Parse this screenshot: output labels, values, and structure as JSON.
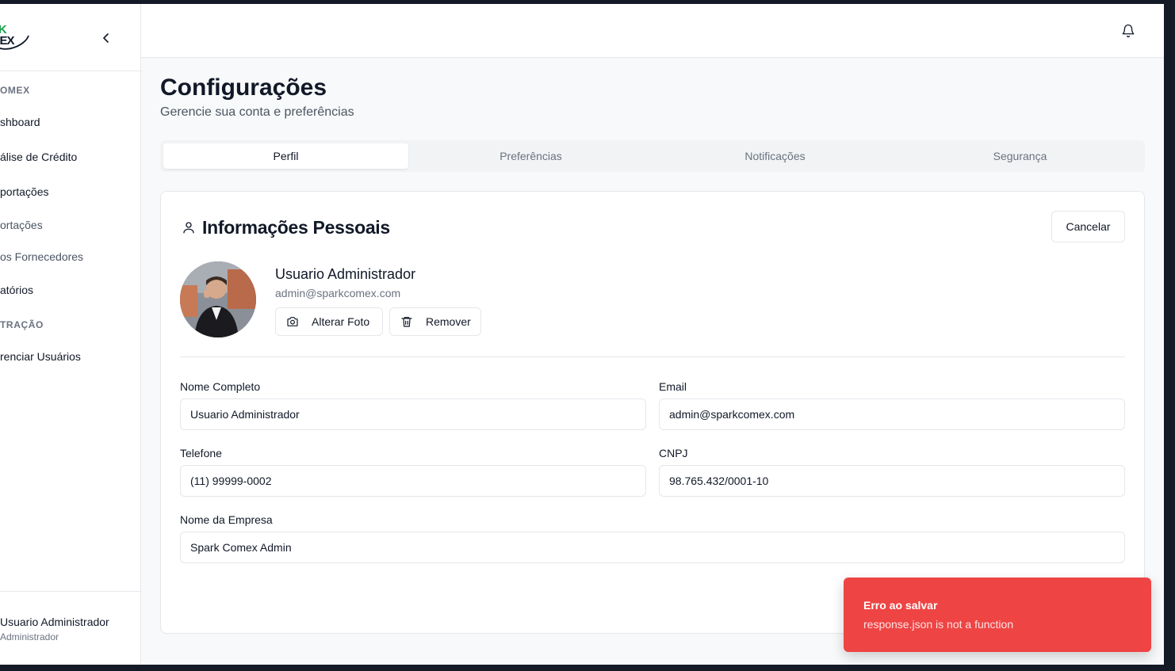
{
  "app": {
    "logo_line1": "RK",
    "logo_line2": "MEX",
    "brand_color": "#16a34a"
  },
  "sidebar": {
    "section_1": "OMEX",
    "items_1": [
      {
        "label": "shboard"
      },
      {
        "label": "álise de Crédito"
      },
      {
        "label": "portações"
      },
      {
        "label": "ortações"
      },
      {
        "label": "os Fornecedores"
      },
      {
        "label": "atórios"
      }
    ],
    "section_2": "TRAÇÃO",
    "items_2": [
      {
        "label": "renciar Usuários"
      }
    ],
    "user": {
      "name": "Usuario Administrador",
      "role": "Administrador"
    }
  },
  "header": {
    "notification_icon": "bell-icon"
  },
  "page": {
    "title": "Configurações",
    "subtitle": "Gerencie sua conta e preferências"
  },
  "tabs": [
    {
      "label": "Perfil",
      "active": true
    },
    {
      "label": "Preferências",
      "active": false
    },
    {
      "label": "Notificações",
      "active": false
    },
    {
      "label": "Segurança",
      "active": false
    }
  ],
  "card": {
    "title": "Informações Pessoais",
    "cancel_label": "Cancelar",
    "profile": {
      "name": "Usuario Administrador",
      "email": "admin@sparkcomex.com",
      "change_photo_label": "Alterar Foto",
      "remove_label": "Remover"
    },
    "fields": {
      "full_name": {
        "label": "Nome Completo",
        "value": "Usuario Administrador"
      },
      "email": {
        "label": "Email",
        "value": "admin@sparkcomex.com"
      },
      "phone": {
        "label": "Telefone",
        "value": "(11) 99999-0002"
      },
      "cnpj": {
        "label": "CNPJ",
        "value": "98.765.432/0001-10"
      },
      "company": {
        "label": "Nome da Empresa",
        "value": "Spark Comex Admin"
      }
    }
  },
  "toast": {
    "title": "Erro ao salvar",
    "description": "response.json is not a function",
    "color": "#ef4444"
  }
}
